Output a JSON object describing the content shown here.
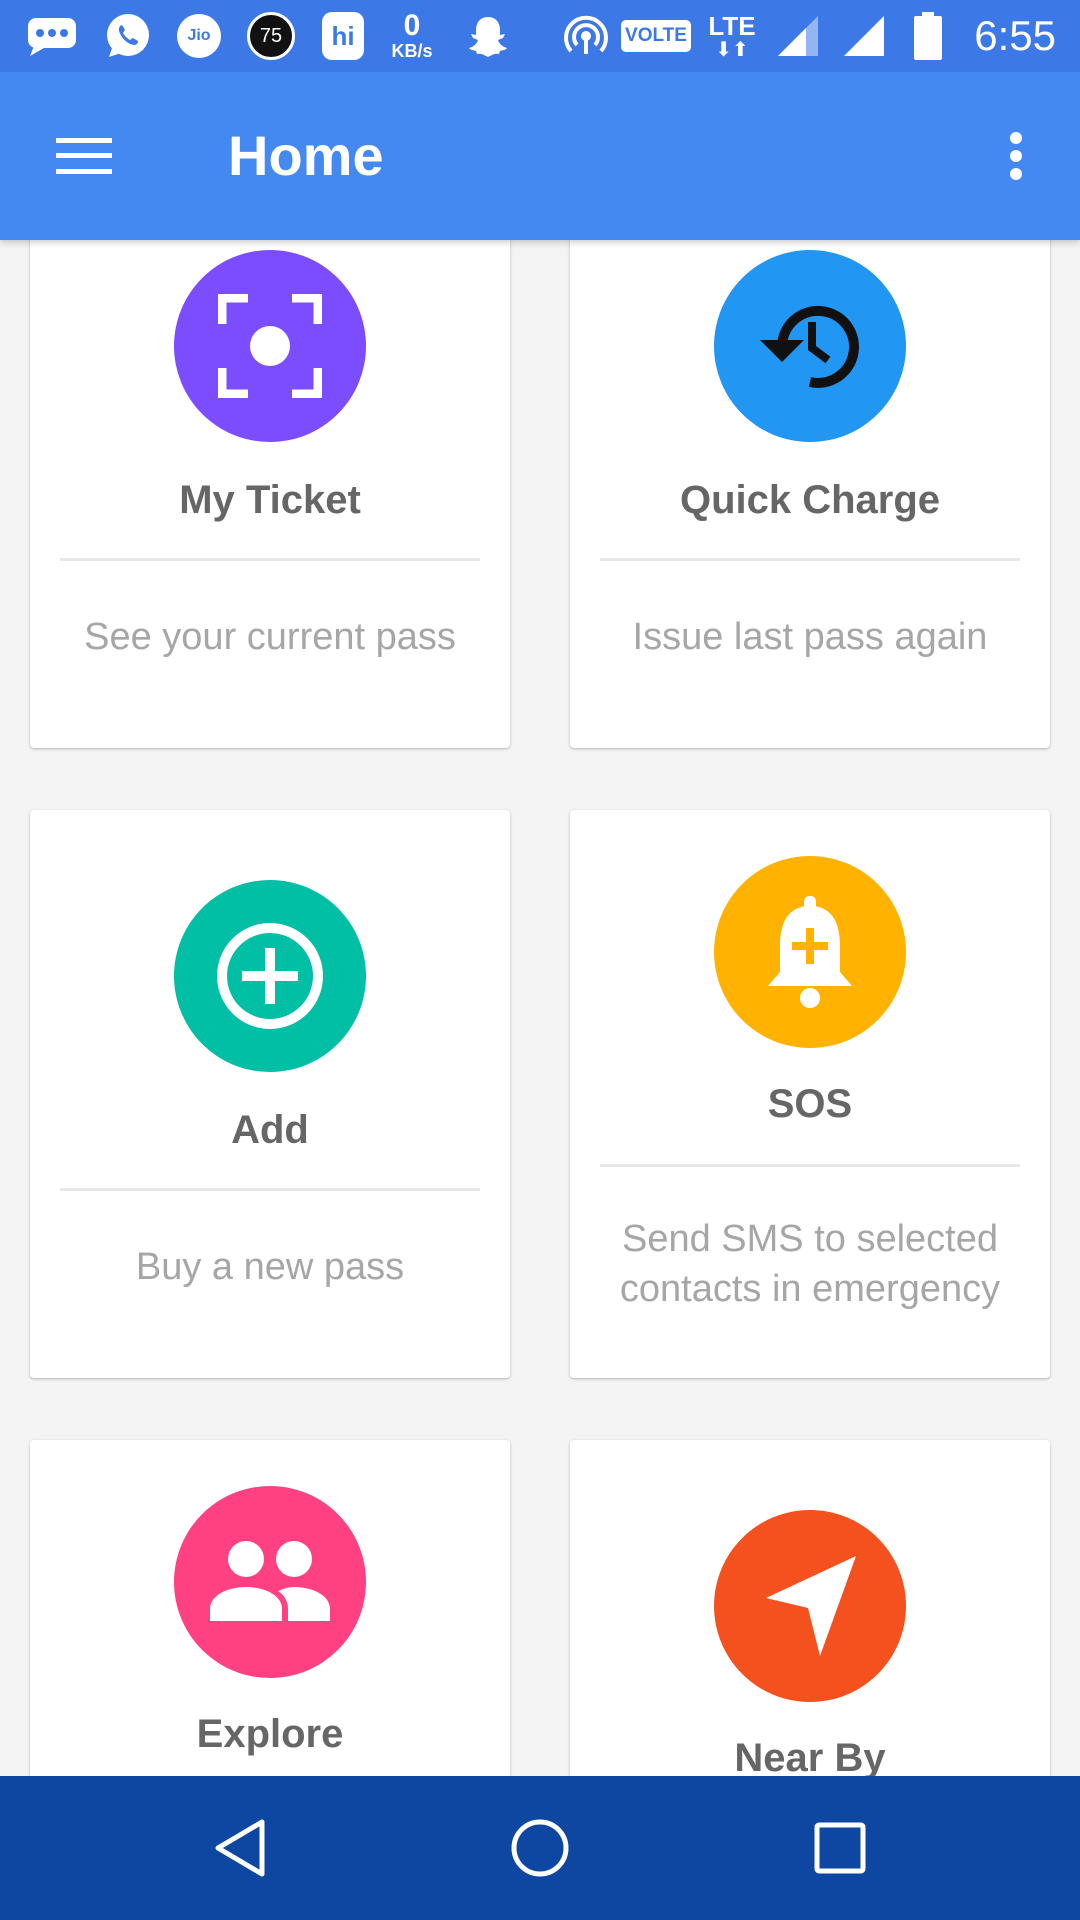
{
  "status_bar": {
    "time": "6:55",
    "net_speed_value": "0",
    "net_speed_unit": "KB/s",
    "jio_label": "Jio",
    "badge_number": "75",
    "hike_label": "hi",
    "volte_label": "VOLTE",
    "lte_label": "LTE",
    "icons": [
      "messaging-icon",
      "whatsapp-icon",
      "jio-icon",
      "badge-icon",
      "hike-icon",
      "network-speed-icon",
      "snapchat-icon",
      "hotspot-icon",
      "volte-icon",
      "lte-icon",
      "signal-icon",
      "signal-icon",
      "battery-icon"
    ]
  },
  "app_bar": {
    "title": "Home",
    "menu_icon": "hamburger-menu-icon",
    "overflow_icon": "more-vertical-icon"
  },
  "cards": [
    {
      "title": "My Ticket",
      "description": "See your current pass",
      "icon": "center-focus-icon",
      "color": "#7c4dff"
    },
    {
      "title": "Quick Charge",
      "description": "Issue last pass again",
      "icon": "restore-history-icon",
      "color": "#2196f3"
    },
    {
      "title": "Add",
      "description": "Buy a new pass",
      "icon": "add-circle-icon",
      "color": "#00bfa5"
    },
    {
      "title": "SOS",
      "description": "Send SMS to selected contacts in emergency",
      "icon": "alarm-add-bell-icon",
      "color": "#ffb300"
    },
    {
      "title": "Explore",
      "description": "",
      "icon": "people-icon",
      "color": "#ff4081"
    },
    {
      "title": "Near By",
      "description": "",
      "icon": "navigation-icon",
      "color": "#f4511e"
    }
  ],
  "nav_bar": {
    "back_icon": "back-triangle-icon",
    "home_icon": "home-circle-icon",
    "recents_icon": "recents-square-icon"
  },
  "colors": {
    "status_bar": "#3d79e6",
    "app_bar": "#4488f2",
    "nav_bar": "#0d47a1",
    "background": "#f4f4f4"
  }
}
